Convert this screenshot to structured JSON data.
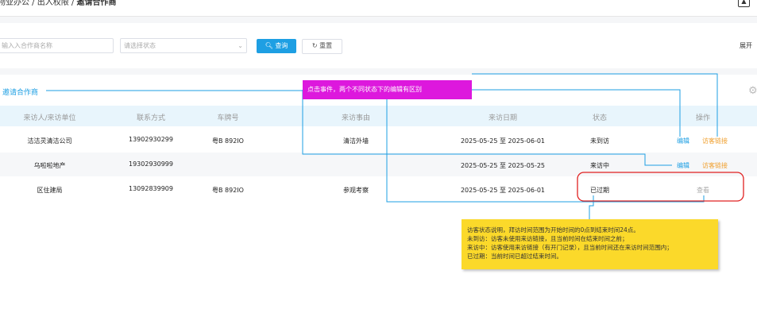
{
  "breadcrumb": {
    "path": "物业办公 / 出入权限 / ",
    "current": "邀请合作商"
  },
  "filters": {
    "name_placeholder": "输入入合作商名称",
    "status_placeholder": "请选择状态",
    "query_label": "查询",
    "reset_label": "重置",
    "expand_label": "展开"
  },
  "panel": {
    "title": "邀请合作商"
  },
  "table": {
    "headers": [
      "来访人/来访单位",
      "联系方式",
      "车牌号",
      "来访事由",
      "来访日期",
      "状态",
      "操作"
    ],
    "rows": [
      {
        "unit": "洁洁灵清洁公司",
        "phone": "13902930299",
        "plate": "粤B 892IO",
        "reason": "清洁外墙",
        "date": "2025-05-25 至 2025-06-01",
        "status": "未到访",
        "actions": [
          "编辑",
          "访客链接"
        ]
      },
      {
        "unit": "乌啦啦地产",
        "phone": "19302930999",
        "plate": "",
        "reason": "",
        "date": "2025-05-25 至 2025-05-25",
        "status": "来访中",
        "actions": [
          "编辑",
          "访客链接"
        ]
      },
      {
        "unit": "区住建局",
        "phone": "13092839909",
        "plate": "粤B 892IO",
        "reason": "参观考察",
        "date": "2025-05-25 至 2025-06-01",
        "status": "已过期",
        "actions": [
          "查看"
        ]
      }
    ]
  },
  "annotations": {
    "edit_note": "点击事件，两个不同状态下的编辑有区别",
    "status_note": [
      "访客状态说明，拜访时间范围为开始时间的0点到结束时间24点。",
      "未到访：访客未使用来访链接，且当前时间在结束时间之前；",
      "来访中：访客使用来访链接（有开门记录），且当前时间还在来访时间范围内；",
      "已过期：当前时间已超过结束时间。"
    ]
  },
  "colors": {
    "primary": "#1e9fe3",
    "link_orange": "#f0a030",
    "annotation_pink": "#dd18dd",
    "annotation_yellow": "#fbd92a",
    "highlight_red": "#e02020"
  }
}
